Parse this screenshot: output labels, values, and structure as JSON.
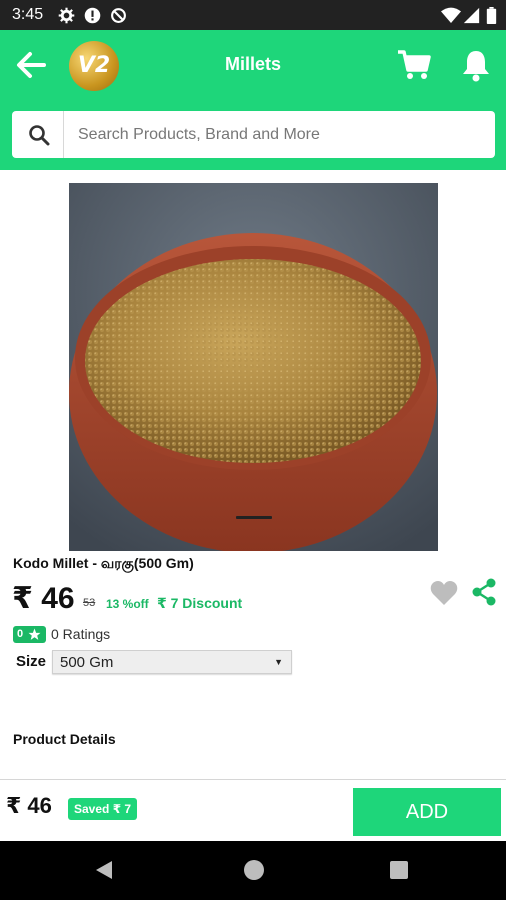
{
  "status_bar": {
    "time": "3:45"
  },
  "app_bar": {
    "title": "Millets",
    "logo_text": "V2"
  },
  "search": {
    "placeholder": "Search Products, Brand and More"
  },
  "product": {
    "name": "Kodo Millet - வரகு(500 Gm)",
    "price": "₹ 46",
    "mrp": "53",
    "percent_off": "13 %off",
    "discount": "₹ 7 Discount",
    "rating_value": "0",
    "ratings_text": "0 Ratings",
    "size_label": "Size",
    "size_selected": "500 Gm",
    "details_title": "Product Details"
  },
  "bottom": {
    "price": "₹ 46",
    "saved": "Saved ₹ 7",
    "add_label": "ADD"
  },
  "colors": {
    "accent": "#1ed67a",
    "discount_green": "#1bb865",
    "status_bar": "#222222"
  }
}
